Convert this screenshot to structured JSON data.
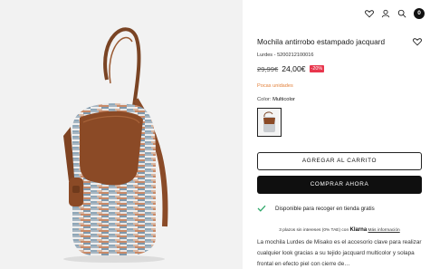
{
  "product": {
    "title": "Mochila antirrobo estampado jacquard",
    "reference": "Lurdes - 5200212100016",
    "price_old": "29,99€",
    "price_new": "24,00€",
    "discount": "-20%",
    "stock_text": "Pocas unidades",
    "color_label": "Color:",
    "color_value": "Multicolor",
    "description": "La mochila Lurdes de Misako es el accesorio clave para realizar cualquier look gracias a su tejido jacquard multicolor y solapa frontal en efecto piel con cierre de…"
  },
  "actions": {
    "add_to_cart": "AGREGAR AL CARRITO",
    "buy_now": "COMPRAR AHORA"
  },
  "pickup": {
    "text": "Disponible para recoger en tienda gratis"
  },
  "klarna": {
    "text": "3 plazos sin intereses (0% TAE) con",
    "brand": "Klarna",
    "link": "Más información"
  },
  "header": {
    "icons": [
      "heart-icon",
      "user-icon",
      "search-icon",
      "cart-icon"
    ],
    "cart_count": "0"
  },
  "colors": {
    "discount_bg": "#e8364d",
    "stock_text": "#e3813b",
    "buy_button": "#0f0f0f",
    "check_icon": "#2fa86a"
  }
}
